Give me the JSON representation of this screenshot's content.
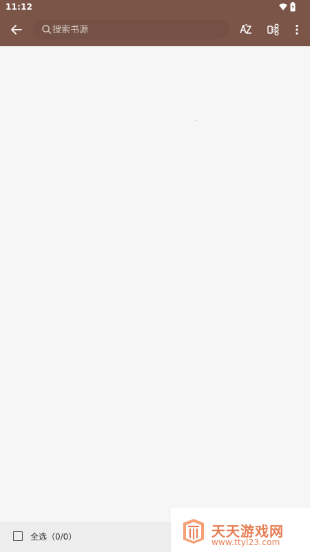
{
  "status_bar": {
    "time": "11:12",
    "wifi_icon": "wifi-icon",
    "battery_icon": "battery-icon"
  },
  "toolbar": {
    "back_icon": "arrow-left-icon",
    "search_placeholder": "搜索书源",
    "search_value": "",
    "search_icon": "search-icon",
    "sort_icon": "sort-az-icon",
    "group_icon": "group-icon",
    "more_icon": "more-vert-icon"
  },
  "content": {
    "items": []
  },
  "bottom_bar": {
    "select_all_label": "全选（0/0）",
    "checked": false
  },
  "watermark": {
    "title": "天天游戏网",
    "url": "www.ttyl23.com"
  },
  "colors": {
    "header": "#7a5548",
    "background": "#f6f6f6",
    "bottom_bar": "#ededed",
    "watermark": "#e67d54"
  }
}
